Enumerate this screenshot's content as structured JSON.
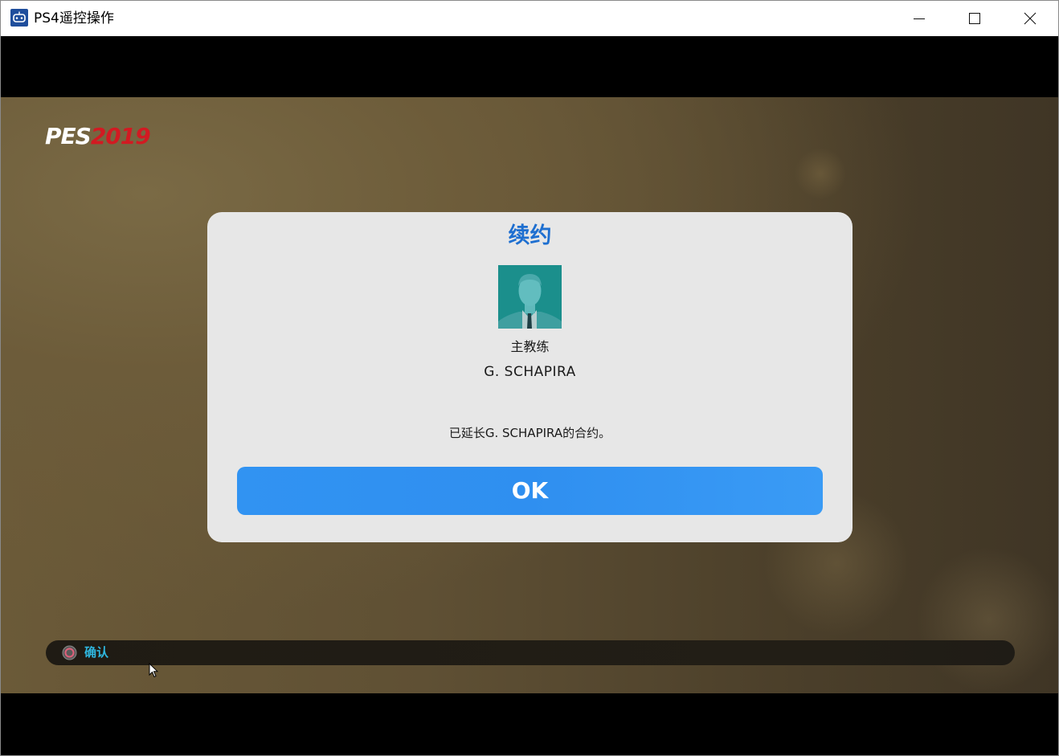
{
  "window": {
    "title": "PS4遥控操作",
    "controls": [
      "minimize-icon",
      "maximize-icon",
      "close-icon"
    ]
  },
  "game": {
    "logo": {
      "pes": "PES",
      "year": "2019"
    },
    "dialog": {
      "title": "续约",
      "role": "主教练",
      "name": "G. SCHAPIRA",
      "message": "已延长G. SCHAPIRA的合约。",
      "ok_label": "OK"
    },
    "hint_bar": {
      "button_icon": "circle-button-icon",
      "label": "确认"
    }
  },
  "colors": {
    "dialog_title": "#1e6fd0",
    "ok_button": "#2f8ff0",
    "hint_label": "#2fb7e0",
    "logo_year": "#d21a22",
    "avatar_bg": "#1b8f8c"
  }
}
